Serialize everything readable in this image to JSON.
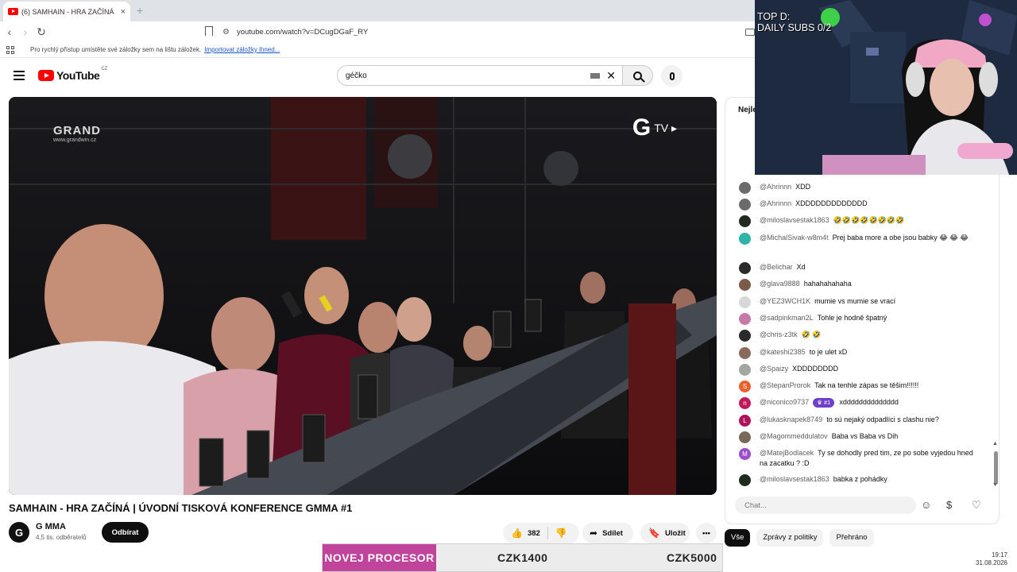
{
  "browser": {
    "tab_title": "(6) SAMHAIN - HRA ZAČÍNÁ",
    "url": "youtube.com/watch?v=DCugDGaF_RY",
    "bookmarks_text": "Pro rychlý přístup umístěte své záložky sem na lištu záložek.",
    "bookmarks_link": "Importovat záložky ihned..."
  },
  "youtube": {
    "logo_word": "YouTube",
    "region": "CZ",
    "search_value": "géčko"
  },
  "video": {
    "watermark_left": "GRAND",
    "watermark_left_sub": "www.grandwin.cz",
    "watermark_right_g": "G",
    "watermark_right_tv": "TV ▸",
    "title": "SAMHAIN - HRA ZAČÍNÁ | ÚVODNÍ TISKOVÁ KONFERENCE GMMA #1",
    "channel_logo": "G",
    "channel_name": "G MMA",
    "channel_subs": "4,5 tis. odběratelů",
    "subscribe_label": "Odbírat",
    "like_count": "382",
    "share_label": "Sdílet",
    "save_label": "Uložit"
  },
  "chat": {
    "header": "Nejle",
    "placeholder": "Chat...",
    "messages": [
      {
        "author": "@Ahrinnn",
        "text": "XDD",
        "avatar_color": "#6b6b6b",
        "avatar": ""
      },
      {
        "author": "@Ahrinnn",
        "text": "XDDDDDDDDDDDDD",
        "avatar_color": "#6b6b6b",
        "avatar": ""
      },
      {
        "author": "@miloslavsestak1863",
        "text": "🤣🤣🤣🤣🤣🤣🤣🤣",
        "avatar_color": "#1e2b1e",
        "avatar": ""
      },
      {
        "author": "@MichalSivak-w8m4t",
        "text": "Prej baba more a obe jsou babky 😂 😂 😂",
        "avatar_color": "#2db3a7",
        "avatar": ""
      },
      {
        "author": "@Belichar",
        "text": "Xd",
        "avatar_color": "#2b2b2b",
        "avatar": ""
      },
      {
        "author": "@glava9888",
        "text": "hahahahahaha",
        "avatar_color": "#7a5a48",
        "avatar": ""
      },
      {
        "author": "@YEZ3WCH1K",
        "text": "mumie vs mumie se vrací",
        "avatar_color": "#d8d8d8",
        "avatar": ""
      },
      {
        "author": "@sadpinkman2L",
        "text": "Tohle je hodně špatný",
        "avatar_color": "#c77aa8",
        "avatar": ""
      },
      {
        "author": "@chris-z3tk",
        "text": "🤣 🤣",
        "avatar_color": "#2a2a2a",
        "avatar": ""
      },
      {
        "author": "@kateshi2385",
        "text": "to je ulet xD",
        "avatar_color": "#8a6a5a",
        "avatar": ""
      },
      {
        "author": "@Spaizy",
        "text": "XDDDDDDDD",
        "avatar_color": "#a0a8a0",
        "avatar": ""
      },
      {
        "author": "@StepanProrok",
        "text": "Tak na tenhle zápas se těšim!!!!!!",
        "avatar_color": "#e8622e",
        "avatar": "S"
      },
      {
        "author": "@niconico9737",
        "badge": "♛ #1",
        "text": "xdddddddddddddd",
        "avatar_color": "#c2185b",
        "avatar": "n"
      },
      {
        "author": "@lukasknapek8749",
        "text": "to sú nejaký odpadlíci s clashu nie?",
        "avatar_color": "#b0125a",
        "avatar": "L"
      },
      {
        "author": "@Magommeddulatov",
        "text": "Baba vs Baba vs Dih",
        "avatar_color": "#7a6a5a",
        "avatar": ""
      },
      {
        "author": "@MatejBodlacek",
        "text": "Ty se dohodly pred tim, ze po sobe vyjedou hned na zacatku ? :D",
        "avatar_color": "#9c4dcc",
        "avatar": "M"
      },
      {
        "author": "@miloslavsestak1863",
        "text": "babka z pohádky",
        "avatar_color": "#1e2b1e",
        "avatar": ""
      }
    ],
    "chips": [
      "Vše",
      "Zprávy z politiky",
      "Přehráno"
    ]
  },
  "stream_overlay": {
    "cam_line1": "TOP D:",
    "cam_line2": "DAILY SUBS 0/2",
    "ticker_promo": "NOVEJ PROCESOR",
    "ticker_price1": "CZK1400",
    "ticker_price2": "CZK5000",
    "clock_time": "19:17",
    "clock_date": "31.08.2026"
  },
  "colors": {
    "yt_red": "#ff0000",
    "promo_pink": "#c0439c",
    "link_blue": "#1a57c8"
  }
}
